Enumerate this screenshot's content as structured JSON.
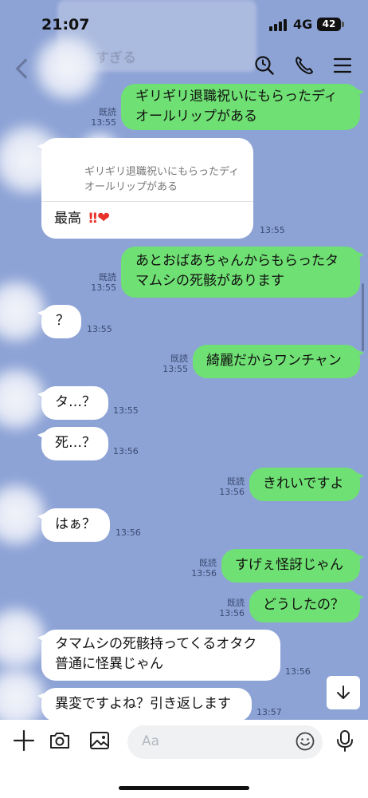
{
  "status": {
    "time": "21:07",
    "network": "4G",
    "battery": "42"
  },
  "faded_banner": {
    "text": "すぎる"
  },
  "header": {
    "icons": [
      "search-icon",
      "phone-icon",
      "menu-icon"
    ]
  },
  "messages": [
    {
      "side": "sent",
      "lines": [
        "ギリギリ退職祝いにもらったディ",
        "オールリップがある"
      ],
      "read": "既読",
      "time": "13:55"
    },
    {
      "side": "recv",
      "quote": [
        "ギリギリ退職祝いにもらったディ",
        "オールリップがある"
      ],
      "text": "最高",
      "emoji": "‼️❤️",
      "time": "13:55"
    },
    {
      "side": "sent",
      "lines": [
        "あとおばあちゃんからもらったタ",
        "マムシの死骸があります"
      ],
      "read": "既読",
      "time": "13:55"
    },
    {
      "side": "recv",
      "text": "？",
      "time": "13:55"
    },
    {
      "side": "sent",
      "lines": [
        "綺麗だからワンチャン"
      ],
      "read": "既読",
      "time": "13:55"
    },
    {
      "side": "recv",
      "text": "タ…？",
      "time": "13:55"
    },
    {
      "side": "recv",
      "text": "死…？",
      "time": "13:56"
    },
    {
      "side": "sent",
      "lines": [
        "きれいですよ"
      ],
      "read": "既読",
      "time": "13:56"
    },
    {
      "side": "recv",
      "text": "はぁ？",
      "time": "13:56"
    },
    {
      "side": "sent",
      "lines": [
        "すげぇ怪訝じゃん"
      ],
      "read": "既読",
      "time": "13:56"
    },
    {
      "side": "sent",
      "lines": [
        "どうしたの？"
      ],
      "read": "既読",
      "time": "13:56"
    },
    {
      "side": "recv",
      "lines": [
        "タマムシの死骸持ってくるオタク",
        "普通に怪異じゃん"
      ],
      "time": "13:56"
    },
    {
      "side": "recv",
      "lines": [
        "異変ですよね？引き返します"
      ],
      "time": "13:57"
    }
  ],
  "input": {
    "placeholder": "Aa"
  },
  "colors": {
    "background": "#8da3d6",
    "sent_bubble": "#6fe073",
    "received_bubble": "#ffffff"
  }
}
